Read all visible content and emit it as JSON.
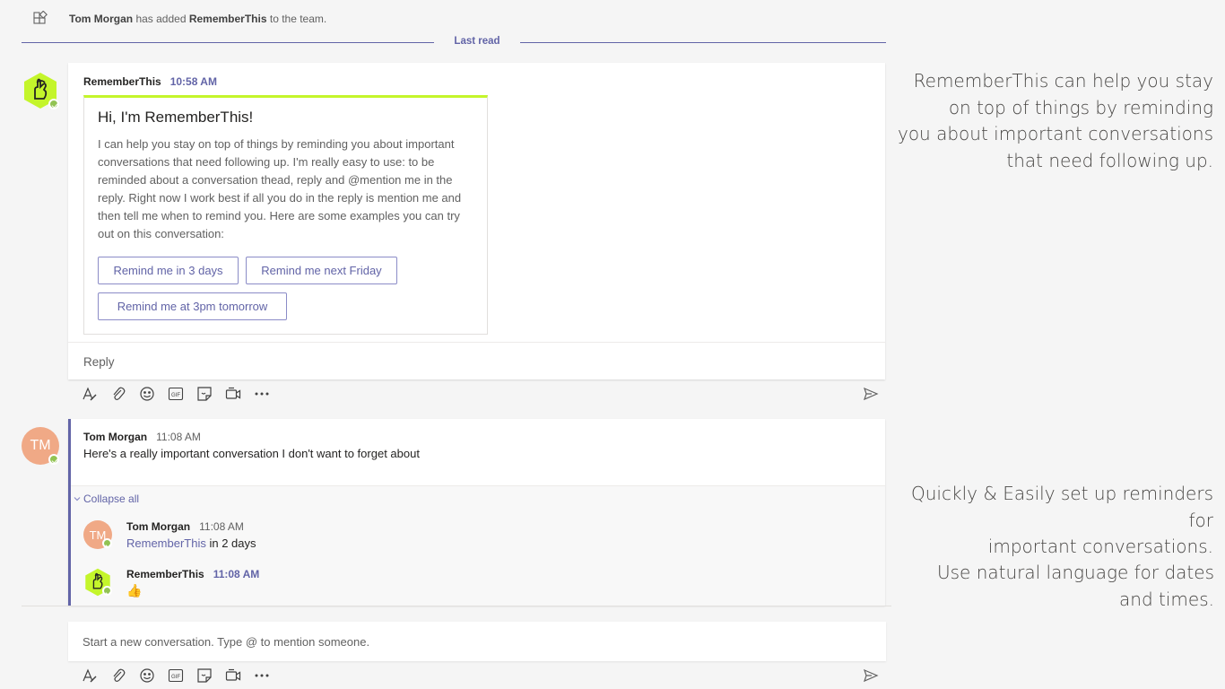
{
  "system_message": {
    "actor": "Tom Morgan",
    "middle": " has added ",
    "subject": "RememberThis",
    "suffix": " to the team."
  },
  "last_read_label": "Last read",
  "thread1": {
    "author": "RememberThis",
    "time": "10:58 AM",
    "card": {
      "title": "Hi, I'm RememberThis!",
      "body": "I can help you stay on top of things by reminding you about important conversations that need following up. I'm really easy to use: to be reminded about a conversation thead, reply and @mention me in the reply. Right now I work best if all you do in the reply is mention me and then tell me when to remind you. Here are some examples you can try out on this conversation:",
      "buttons": [
        "Remind me in 3 days",
        "Remind me next Friday",
        "Remind me at 3pm tomorrow"
      ]
    },
    "reply_label": "Reply"
  },
  "thread2": {
    "author": "Tom Morgan",
    "initials": "TM",
    "time": "11:08 AM",
    "text": "Here's a really important conversation I don't want to forget about",
    "collapse_label": "Collapse all",
    "replies": [
      {
        "author": "Tom Morgan",
        "initials": "TM",
        "time": "11:08 AM",
        "mention": "RememberThis",
        "text": " in 2 days"
      },
      {
        "author": "RememberThis",
        "time": "11:08 AM",
        "emoji": "👍"
      }
    ]
  },
  "compose_placeholder": "Start a new conversation. Type @ to mention someone.",
  "toolbar_icons": [
    "format-icon",
    "attach-icon",
    "emoji-icon",
    "gif-icon",
    "sticker-icon",
    "meet-now-icon",
    "more-options-icon"
  ],
  "promo": {
    "block1": [
      "RememberThis can help you stay",
      "on top of things by reminding",
      "you about important conversations",
      "that need following up."
    ],
    "block2": [
      "Quickly & Easily set up reminders for",
      "important conversations."
    ],
    "block3": [
      "Use natural language for dates",
      "and times."
    ]
  },
  "colors": {
    "accent": "#6264a7",
    "bot_green": "#c4f52b",
    "presence": "#92c353",
    "avatar_tm": "#f0a986"
  }
}
